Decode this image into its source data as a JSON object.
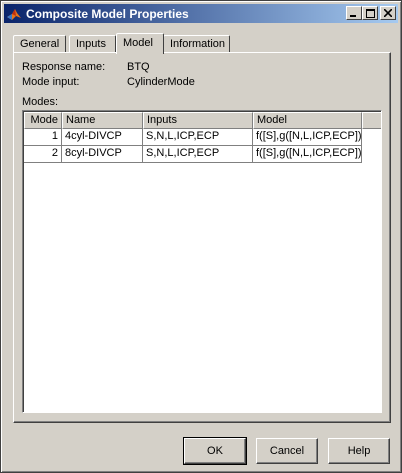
{
  "window": {
    "title": "Composite Model Properties"
  },
  "tabs": [
    {
      "label": "General"
    },
    {
      "label": "Inputs"
    },
    {
      "label": "Model",
      "active": true
    },
    {
      "label": "Information"
    }
  ],
  "info": {
    "response_label": "Response name:",
    "response_value": "BTQ",
    "mode_label": "Mode input:",
    "mode_value": "CylinderMode",
    "modes_label": "Modes:"
  },
  "table": {
    "columns": [
      "Mode",
      "Name",
      "Inputs",
      "Model",
      ""
    ],
    "rows": [
      [
        "1",
        "4cyl-DIVCP",
        "S,N,L,ICP,ECP",
        "f([S],g([N,L,ICP,ECP]))",
        ""
      ],
      [
        "2",
        "8cyl-DIVCP",
        "S,N,L,ICP,ECP",
        "f([S],g([N,L,ICP,ECP]))",
        ""
      ]
    ]
  },
  "buttons": {
    "ok": "OK",
    "cancel": "Cancel",
    "help": "Help"
  },
  "colors": {
    "title_gradient_start": "#0a246a",
    "title_gradient_end": "#a6caf0",
    "face": "#d4d0c8"
  }
}
